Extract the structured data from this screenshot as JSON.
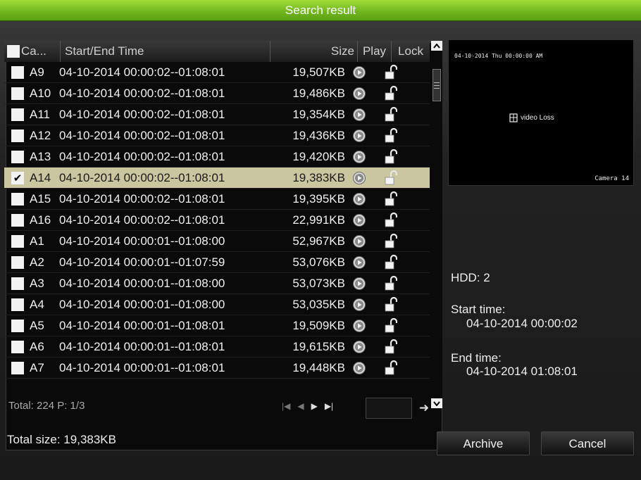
{
  "title": "Search result",
  "columns": {
    "cam": "Ca...",
    "time": "Start/End Time",
    "size": "Size",
    "play": "Play",
    "lock": "Lock"
  },
  "rows": [
    {
      "cam": "A9",
      "time": "04-10-2014 00:00:02--01:08:01",
      "size": "19,507KB",
      "checked": false
    },
    {
      "cam": "A10",
      "time": "04-10-2014 00:00:02--01:08:01",
      "size": "19,486KB",
      "checked": false
    },
    {
      "cam": "A11",
      "time": "04-10-2014 00:00:02--01:08:01",
      "size": "19,354KB",
      "checked": false
    },
    {
      "cam": "A12",
      "time": "04-10-2014 00:00:02--01:08:01",
      "size": "19,436KB",
      "checked": false
    },
    {
      "cam": "A13",
      "time": "04-10-2014 00:00:02--01:08:01",
      "size": "19,420KB",
      "checked": false
    },
    {
      "cam": "A14",
      "time": "04-10-2014 00:00:02--01:08:01",
      "size": "19,383KB",
      "checked": true
    },
    {
      "cam": "A15",
      "time": "04-10-2014 00:00:02--01:08:01",
      "size": "19,395KB",
      "checked": false
    },
    {
      "cam": "A16",
      "time": "04-10-2014 00:00:02--01:08:01",
      "size": "22,991KB",
      "checked": false
    },
    {
      "cam": "A1",
      "time": "04-10-2014 00:00:01--01:08:00",
      "size": "52,967KB",
      "checked": false
    },
    {
      "cam": "A2",
      "time": "04-10-2014 00:00:01--01:07:59",
      "size": "53,076KB",
      "checked": false
    },
    {
      "cam": "A3",
      "time": "04-10-2014 00:00:01--01:08:00",
      "size": "53,073KB",
      "checked": false
    },
    {
      "cam": "A4",
      "time": "04-10-2014 00:00:01--01:08:00",
      "size": "53,035KB",
      "checked": false
    },
    {
      "cam": "A5",
      "time": "04-10-2014 00:00:01--01:08:01",
      "size": "19,509KB",
      "checked": false
    },
    {
      "cam": "A6",
      "time": "04-10-2014 00:00:01--01:08:01",
      "size": "19,615KB",
      "checked": false
    },
    {
      "cam": "A7",
      "time": "04-10-2014 00:00:01--01:08:01",
      "size": "19,448KB",
      "checked": false
    }
  ],
  "footer": {
    "total": "Total: 224  P: 1/3"
  },
  "preview": {
    "datetime": "04-10-2014 Thu 00:00:00 AM",
    "status": "video Loss",
    "camera": "Camera 14"
  },
  "info": {
    "hdd": "HDD: 2",
    "start_label": "Start time:",
    "start_value": "04-10-2014 00:00:02",
    "end_label": "End time:",
    "end_value": "04-10-2014 01:08:01"
  },
  "bottom": {
    "total_size": "Total size: 19,383KB",
    "archive": "Archive",
    "cancel": "Cancel"
  },
  "icons": {
    "play": "play-circle-icon",
    "lock": "unlock-icon"
  },
  "colors": {
    "title_bar": "#7fc52a",
    "selected_row": "#c9c6a0"
  }
}
